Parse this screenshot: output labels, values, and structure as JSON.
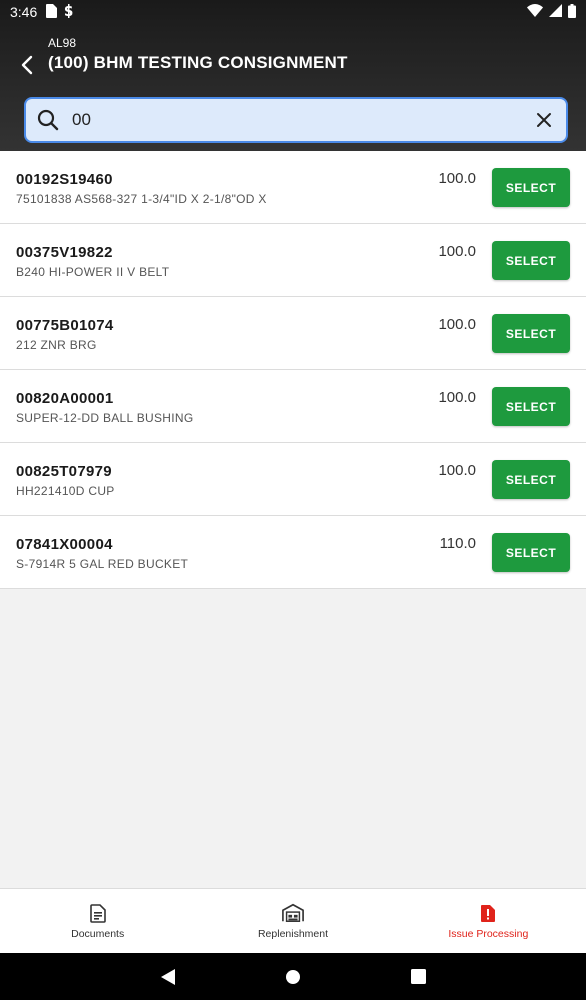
{
  "status_bar": {
    "time": "3:46"
  },
  "header": {
    "subtitle": "AL98",
    "title": "(100) BHM TESTING CONSIGNMENT"
  },
  "search": {
    "value": "00",
    "placeholder": ""
  },
  "items": [
    {
      "code": "00192S19460",
      "description": "75101838 AS568-327 1-3/4\"ID X 2-1/8\"OD X",
      "qty": "100.0",
      "action": "SELECT"
    },
    {
      "code": "00375V19822",
      "description": "B240 HI-POWER II V BELT",
      "qty": "100.0",
      "action": "SELECT"
    },
    {
      "code": "00775B01074",
      "description": "212 ZNR BRG",
      "qty": "100.0",
      "action": "SELECT"
    },
    {
      "code": "00820A00001",
      "description": "SUPER-12-DD BALL BUSHING",
      "qty": "100.0",
      "action": "SELECT"
    },
    {
      "code": "00825T07979",
      "description": "HH221410D CUP",
      "qty": "100.0",
      "action": "SELECT"
    },
    {
      "code": "07841X00004",
      "description": "S-7914R 5 GAL RED BUCKET",
      "qty": "110.0",
      "action": "SELECT"
    }
  ],
  "bottom_nav": {
    "documents": "Documents",
    "replenishment": "Replenishment",
    "issue_processing": "Issue Processing"
  },
  "colors": {
    "accent_green": "#1e9a3e",
    "active_red": "#e0231b",
    "search_border": "#4a8ae8"
  }
}
